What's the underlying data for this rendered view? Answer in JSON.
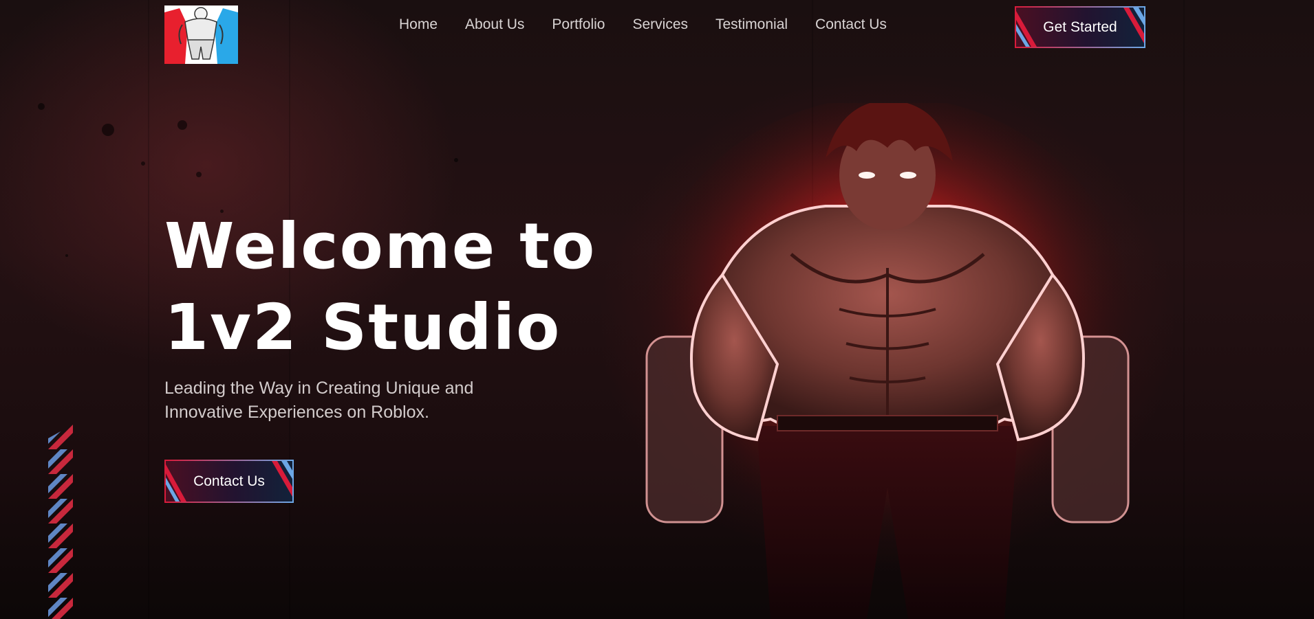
{
  "header": {
    "logo": {
      "icon": "muscle-mascot-logo-icon",
      "colors": [
        "#e8202e",
        "#2aa8e8",
        "#ffffff"
      ]
    },
    "nav": [
      {
        "label": "Home"
      },
      {
        "label": "About Us"
      },
      {
        "label": "Portfolio"
      },
      {
        "label": "Services"
      },
      {
        "label": "Testimonial"
      },
      {
        "label": "Contact Us"
      }
    ],
    "cta_label": "Get Started"
  },
  "hero": {
    "title_line1": "Welcome to",
    "title_line2": "1v2 Studio",
    "subtitle_line1": "Leading the Way in Creating Unique and",
    "subtitle_line2": "Innovative Experiences on Roblox.",
    "contact_label": "Contact Us",
    "figure_icon": "glowing-muscle-fighter-illustration"
  },
  "theme": {
    "accent_red": "#d81b3a",
    "accent_blue": "#6ba7e6",
    "background": "#1a0f10",
    "text": "#ffffff"
  }
}
